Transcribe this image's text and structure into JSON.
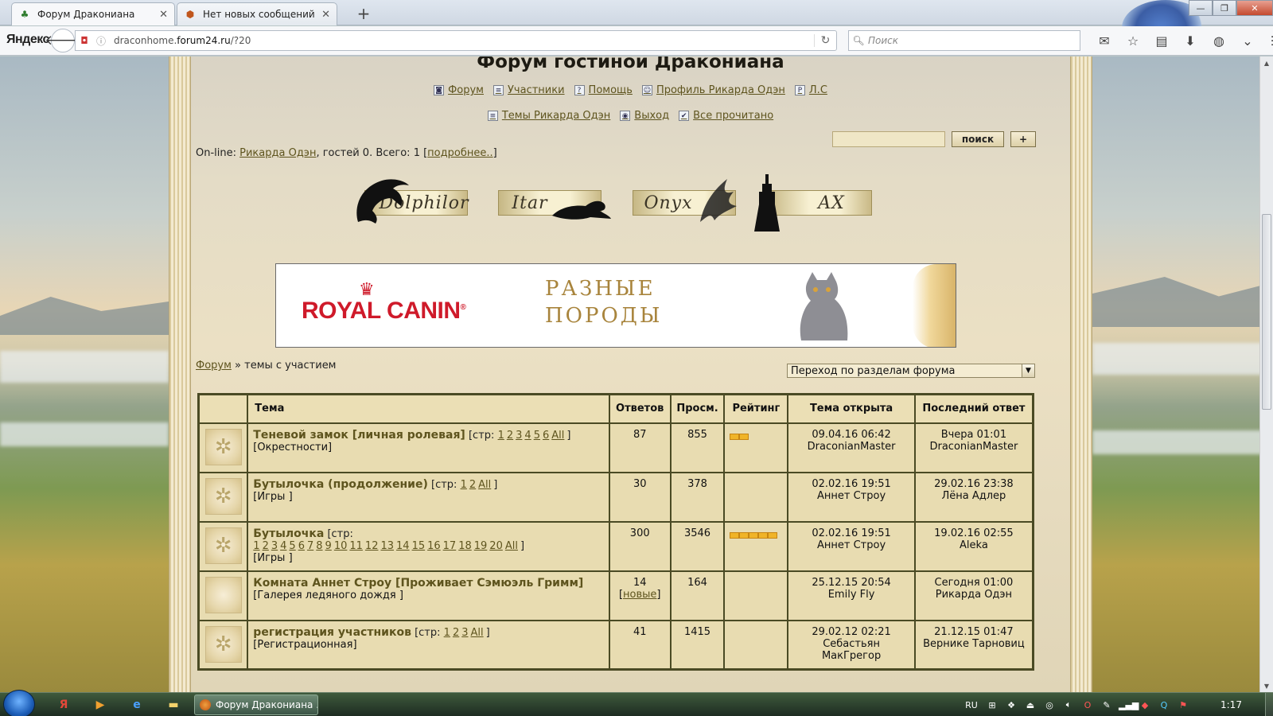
{
  "browser": {
    "tabs": [
      {
        "title": "Форум Дракониана",
        "active": true
      },
      {
        "title": "Нет новых сообщений",
        "active": false
      }
    ],
    "new_tab_label": "+",
    "window_controls": {
      "minimize": "—",
      "maximize": "❐",
      "close": "✕"
    },
    "brand": "Яндекс",
    "url_host": "draconhome.forum24.ru",
    "url_path": "/?20",
    "url_prefix": "draconhome.",
    "url_domain": "forum24.ru",
    "url_rest": "/?20",
    "search_placeholder": "Поиск",
    "icons": [
      "mail-icon",
      "bookmark-star-icon",
      "reading-list-icon",
      "download-icon",
      "addon-icon",
      "overflow-icon",
      "menu-icon"
    ]
  },
  "forum": {
    "title": "Форум гостиной Дракониана",
    "menu1": [
      {
        "icon": "◙",
        "label": "Форум"
      },
      {
        "icon": "≡",
        "label": "Участники"
      },
      {
        "icon": "?",
        "label": "Помощь"
      },
      {
        "icon": "☺",
        "label": "Профиль Рикарда Одэн"
      },
      {
        "icon": "P",
        "label": "Л.С"
      }
    ],
    "menu2": [
      {
        "icon": "≡",
        "label": "Темы Рикарда Одэн"
      },
      {
        "icon": "◉",
        "label": "Выход"
      },
      {
        "icon": "✔",
        "label": "Все прочитано"
      }
    ],
    "search_button": "поиск",
    "plus_button": "+",
    "online": {
      "prefix": "On-line: ",
      "user": "Рикарда Одэн",
      "middle": ", гостей 0. Всего: 1 [",
      "more": "подробнее..",
      "suffix": "]"
    },
    "banners": [
      "Dolphilor",
      "Itar",
      "Onyx",
      "AX"
    ],
    "ad": {
      "brand": "ROYAL CANIN",
      "registered": "®",
      "line1": "РАЗНЫЕ",
      "line2": "ПОРОДЫ"
    },
    "breadcrumb": {
      "root": "Форум",
      "separator": " » ",
      "current": "темы с участием"
    },
    "jump_select": "Переход по разделам форума",
    "table": {
      "headers": [
        "Тема",
        "Ответов",
        "Просм.",
        "Рейтинг",
        "Тема открыта",
        "Последний ответ"
      ],
      "rows": [
        {
          "title": "Теневой замок [личная ролевая]",
          "pages_prefix": "[стр:",
          "pages": [
            "1",
            "2",
            "3",
            "4",
            "5",
            "6",
            "All"
          ],
          "pages_suffix": "]",
          "section": "[Окрестности]",
          "replies": "87",
          "replies_new": "",
          "views": "855",
          "rating": 2,
          "opened_date": "09.04.16 06:42",
          "opened_by": "DraconianMaster",
          "last_date": "Вчера 01:01",
          "last_by": "DraconianMaster"
        },
        {
          "title": "Бутылочка (продолжение)",
          "pages_prefix": "[стр:",
          "pages": [
            "1",
            "2",
            "All"
          ],
          "pages_suffix": "]",
          "section": "[Игры ]",
          "replies": "30",
          "replies_new": "",
          "views": "378",
          "rating": 0,
          "opened_date": "02.02.16 19:51",
          "opened_by": "Аннет Строу",
          "last_date": "29.02.16 23:38",
          "last_by": "Лёна Адлер"
        },
        {
          "title": "Бутылочка",
          "pages_prefix": "[стр:",
          "pages": [
            "1",
            "2",
            "3",
            "4",
            "5",
            "6",
            "7",
            "8",
            "9",
            "10",
            "11",
            "12",
            "13",
            "14",
            "15",
            "16",
            "17",
            "18",
            "19",
            "20",
            "All"
          ],
          "pages_suffix": "]",
          "section": "[Игры ]",
          "replies": "300",
          "replies_new": "",
          "views": "3546",
          "rating": 5,
          "opened_date": "02.02.16 19:51",
          "opened_by": "Аннет Строу",
          "last_date": "19.02.16 02:55",
          "last_by": "Aleka"
        },
        {
          "title": "Комната Аннет Строу [Проживает Сэмюэль Гримм]",
          "pages_prefix": "",
          "pages": [],
          "pages_suffix": "",
          "section": "[Галерея ледяного дождя ]",
          "replies": "14",
          "replies_new": "новые",
          "views": "164",
          "rating": 0,
          "opened_date": "25.12.15 20:54",
          "opened_by": "Emily Fly",
          "last_date": "Сегодня 01:00",
          "last_by": "Рикарда Одэн"
        },
        {
          "title": "регистрация участников",
          "pages_prefix": "[стр:",
          "pages": [
            "1",
            "2",
            "3",
            "All"
          ],
          "pages_suffix": "]",
          "section": "[Регистрационная]",
          "replies": "41",
          "replies_new": "",
          "views": "1415",
          "rating": 0,
          "opened_date": "29.02.12 02:21",
          "opened_by": "Себастьян МакГрегор",
          "last_date": "21.12.15 01:47",
          "last_by": "Вернике Тарновиц"
        }
      ]
    }
  },
  "taskbar": {
    "task_title": "Форум Дракониана ...",
    "language": "RU",
    "clock": "1:17"
  }
}
